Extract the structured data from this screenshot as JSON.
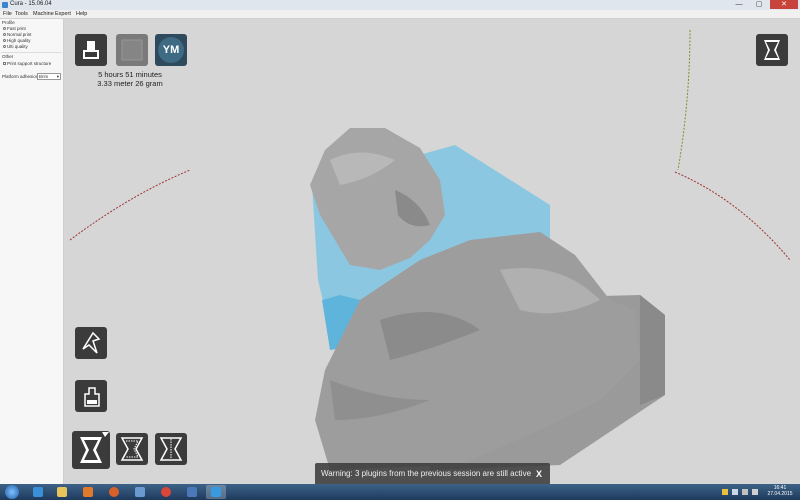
{
  "window": {
    "title": "Cura - 15.06.04",
    "minimize": "—",
    "maximize": "▢",
    "close": "✕"
  },
  "menu": [
    "File",
    "Tools",
    "Machine",
    "Expert",
    "Help"
  ],
  "left_panel": {
    "profile_label": "Profile",
    "profiles": [
      "Fast print",
      "Normal print",
      "High quality",
      "Ulti quality"
    ],
    "other_label": "Other",
    "support_label": "Print support structure",
    "adhesion_label": "Platform adhesion",
    "adhesion_value": "Brim"
  },
  "toolbar": {
    "load_icon": "load-model-icon",
    "print_icon": "print-icon",
    "user_initials": "YM",
    "view_icon": "view-mode-icon"
  },
  "model_info": {
    "print_time": "5 hours 51 minutes",
    "material": "3.33 meter 26 gram"
  },
  "tools": {
    "rotate_icon": "rotate-icon",
    "scale_icon": "scale-icon",
    "mirror_icon": "mirror-icon",
    "mirror_x_icon": "mirror-x-icon",
    "mirror_y_icon": "mirror-y-icon"
  },
  "notification": {
    "text": "Warning: 3 plugins from the previous session are still active",
    "close": "X"
  },
  "taskbar": {
    "time": "16:41",
    "date": "27.04.2015"
  },
  "colors": {
    "build_volume": "#7fc4e4",
    "model": "#9c9c9c",
    "button_bg": "#3b3b3b",
    "taskbar": "#2a4b72"
  }
}
